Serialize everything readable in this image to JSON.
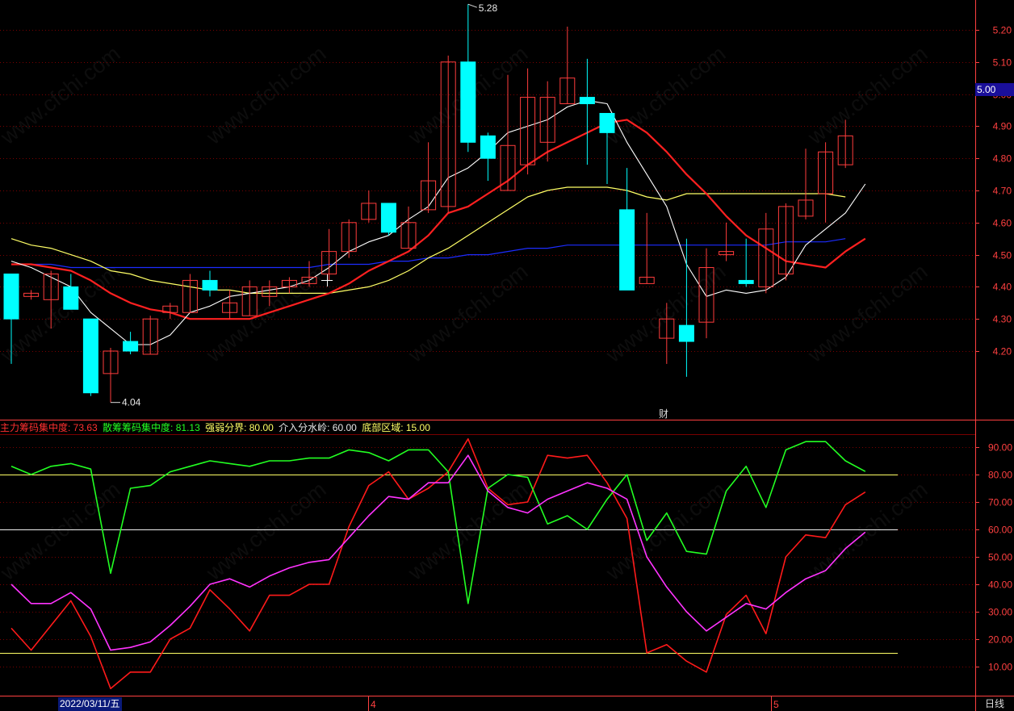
{
  "watermark": "www.cfchi.com",
  "price_tag": "5.00",
  "marks": {
    "high_label": "5.28",
    "low_label": "4.04",
    "fin_mark": "财"
  },
  "bottom": {
    "date": "2022/03/11/五",
    "month_4": "4",
    "month_5": "5",
    "period": "日线"
  },
  "legend": {
    "main_chip": "主力筹码集中度: 73.63",
    "retail_chip": "散筹筹码集中度: 81.13",
    "strong_weak": "强弱分界: 80.00",
    "entry_line": "介入分水岭: 60.00",
    "bottom_zone": "底部区域: 15.00"
  },
  "colors": {
    "up": "#ff3c3c",
    "down": "#00ffff",
    "ma5": "#ffffff",
    "ma10": "#ff2020",
    "ma20": "#ffff66",
    "ma60": "#1c2cff",
    "main": "#ff1a1a",
    "retail": "#22ff22",
    "avg": "#ff33ff",
    "ref": "#ffff66",
    "grid": "#7a0000",
    "axis": "#ff4040"
  },
  "chart_data": [
    {
      "type": "candlestick",
      "ylim": [
        4.04,
        5.28
      ],
      "y_ticks": [
        "4.20",
        "4.30",
        "4.40",
        "4.50",
        "4.60",
        "4.70",
        "4.80",
        "4.90",
        "5.00",
        "5.10",
        "5.20"
      ],
      "candles": [
        [
          4.44,
          4.3,
          4.44,
          4.16
        ],
        [
          4.37,
          4.38,
          4.39,
          4.36
        ],
        [
          4.36,
          4.44,
          4.45,
          4.27
        ],
        [
          4.4,
          4.33,
          4.44,
          4.33
        ],
        [
          4.3,
          4.07,
          4.3,
          4.06
        ],
        [
          4.13,
          4.2,
          4.21,
          4.04
        ],
        [
          4.23,
          4.2,
          4.26,
          4.19
        ],
        [
          4.19,
          4.3,
          4.31,
          4.19
        ],
        [
          4.32,
          4.34,
          4.35,
          4.3
        ],
        [
          4.32,
          4.42,
          4.44,
          4.32
        ],
        [
          4.42,
          4.39,
          4.45,
          4.37
        ],
        [
          4.32,
          4.35,
          4.39,
          4.3
        ],
        [
          4.31,
          4.4,
          4.42,
          4.31
        ],
        [
          4.37,
          4.4,
          4.42,
          4.34
        ],
        [
          4.4,
          4.42,
          4.43,
          4.38
        ],
        [
          4.41,
          4.43,
          4.48,
          4.4
        ],
        [
          4.44,
          4.51,
          4.58,
          4.42
        ],
        [
          4.51,
          4.6,
          4.61,
          4.49
        ],
        [
          4.61,
          4.66,
          4.7,
          4.6
        ],
        [
          4.66,
          4.57,
          4.66,
          4.56
        ],
        [
          4.52,
          4.6,
          4.65,
          4.52
        ],
        [
          4.64,
          4.73,
          4.85,
          4.63
        ],
        [
          4.65,
          5.1,
          5.12,
          4.63
        ],
        [
          5.1,
          4.85,
          5.28,
          4.82
        ],
        [
          4.87,
          4.8,
          4.88,
          4.73
        ],
        [
          4.7,
          4.84,
          5.06,
          4.7
        ],
        [
          4.78,
          4.99,
          5.08,
          4.75
        ],
        [
          4.85,
          4.99,
          5.04,
          4.79
        ],
        [
          4.97,
          5.05,
          5.21,
          4.97
        ],
        [
          4.99,
          4.97,
          5.11,
          4.78
        ],
        [
          4.94,
          4.88,
          4.94,
          4.72
        ],
        [
          4.64,
          4.39,
          4.77,
          4.39
        ],
        [
          4.41,
          4.43,
          4.63,
          4.41
        ],
        [
          4.24,
          4.3,
          4.35,
          4.16
        ],
        [
          4.28,
          4.23,
          4.55,
          4.12
        ],
        [
          4.29,
          4.46,
          4.52,
          4.24
        ],
        [
          4.5,
          4.51,
          4.6,
          4.48
        ],
        [
          4.42,
          4.41,
          4.55,
          4.4
        ],
        [
          4.4,
          4.58,
          4.63,
          4.38
        ],
        [
          4.44,
          4.65,
          4.66,
          4.42
        ],
        [
          4.62,
          4.67,
          4.83,
          4.61
        ],
        [
          4.69,
          4.82,
          4.85,
          4.6
        ],
        [
          4.78,
          4.87,
          4.92,
          4.77
        ]
      ],
      "ma5": [
        4.48,
        4.46,
        4.43,
        4.4,
        4.32,
        4.27,
        4.22,
        4.22,
        4.25,
        4.32,
        4.34,
        4.37,
        4.38,
        4.39,
        4.4,
        4.42,
        4.46,
        4.51,
        4.54,
        4.56,
        4.61,
        4.65,
        4.74,
        4.77,
        4.82,
        4.88,
        4.9,
        4.92,
        4.96,
        4.98,
        4.97,
        4.85,
        4.75,
        4.65,
        4.47,
        4.37,
        4.39,
        4.38,
        4.39,
        4.43,
        4.53,
        4.58,
        4.63,
        4.72
      ],
      "ma10": [
        4.47,
        4.47,
        4.46,
        4.45,
        4.42,
        4.38,
        4.35,
        4.33,
        4.32,
        4.3,
        4.3,
        4.3,
        4.3,
        4.32,
        4.34,
        4.36,
        4.38,
        4.41,
        4.45,
        4.48,
        4.51,
        4.56,
        4.63,
        4.65,
        4.69,
        4.73,
        4.78,
        4.82,
        4.85,
        4.88,
        4.91,
        4.92,
        4.88,
        4.82,
        4.75,
        4.69,
        4.62,
        4.56,
        4.52,
        4.48,
        4.47,
        4.46,
        4.51,
        4.55
      ],
      "ma20": [
        4.55,
        4.53,
        4.52,
        4.5,
        4.48,
        4.45,
        4.44,
        4.42,
        4.41,
        4.4,
        4.39,
        4.39,
        4.38,
        4.38,
        4.38,
        4.38,
        4.38,
        4.39,
        4.4,
        4.42,
        4.45,
        4.49,
        4.52,
        4.56,
        4.6,
        4.64,
        4.68,
        4.7,
        4.71,
        4.71,
        4.71,
        4.7,
        4.68,
        4.67,
        4.69,
        4.69,
        4.69,
        4.69,
        4.69,
        4.69,
        4.69,
        4.69,
        4.68
      ],
      "ma60": [
        4.47,
        4.47,
        4.47,
        4.46,
        4.46,
        4.46,
        4.46,
        4.46,
        4.46,
        4.46,
        4.46,
        4.46,
        4.46,
        4.46,
        4.46,
        4.46,
        4.47,
        4.47,
        4.47,
        4.48,
        4.48,
        4.49,
        4.49,
        4.5,
        4.5,
        4.51,
        4.52,
        4.52,
        4.53,
        4.53,
        4.53,
        4.53,
        4.53,
        4.53,
        4.53,
        4.53,
        4.53,
        4.53,
        4.53,
        4.54,
        4.54,
        4.54,
        4.55
      ]
    },
    {
      "type": "line",
      "ylim": [
        0,
        95
      ],
      "y_ticks": [
        "10.00",
        "20.00",
        "30.00",
        "40.00",
        "50.00",
        "60.00",
        "70.00",
        "80.00",
        "90.00"
      ],
      "reference_lines": [
        80,
        60,
        15
      ],
      "series": [
        {
          "name": "主力筹码集中度",
          "values": [
            24,
            16,
            25,
            34,
            21,
            2,
            8,
            8,
            20,
            24,
            38,
            31,
            23,
            36,
            36,
            40,
            40,
            61,
            76,
            81,
            71,
            75,
            81,
            93,
            75,
            69,
            70,
            87,
            86,
            87,
            77,
            64,
            15,
            18,
            12,
            8,
            29,
            36,
            22,
            50,
            58,
            57,
            69,
            73.63
          ]
        },
        {
          "name": "散筹筹码集中度",
          "values": [
            83,
            80,
            83,
            84,
            82,
            44,
            75,
            76,
            81,
            83,
            85,
            84,
            83,
            85,
            85,
            86,
            86,
            89,
            88,
            85,
            89,
            89,
            81,
            33,
            75,
            80,
            79,
            62,
            65,
            60,
            71,
            80,
            56,
            66,
            52,
            51,
            74,
            83,
            68,
            89,
            92,
            92,
            85,
            81.13
          ]
        },
        {
          "values": [
            40,
            33,
            33,
            37,
            31,
            16,
            17,
            19,
            25,
            32,
            40,
            42,
            39,
            43,
            46,
            48,
            49,
            57,
            65,
            72,
            71,
            77,
            77,
            87,
            74,
            68,
            66,
            71,
            74,
            77,
            75,
            71,
            50,
            39,
            30,
            23,
            28,
            33,
            31,
            37,
            42,
            45,
            53,
            59
          ]
        }
      ]
    }
  ]
}
